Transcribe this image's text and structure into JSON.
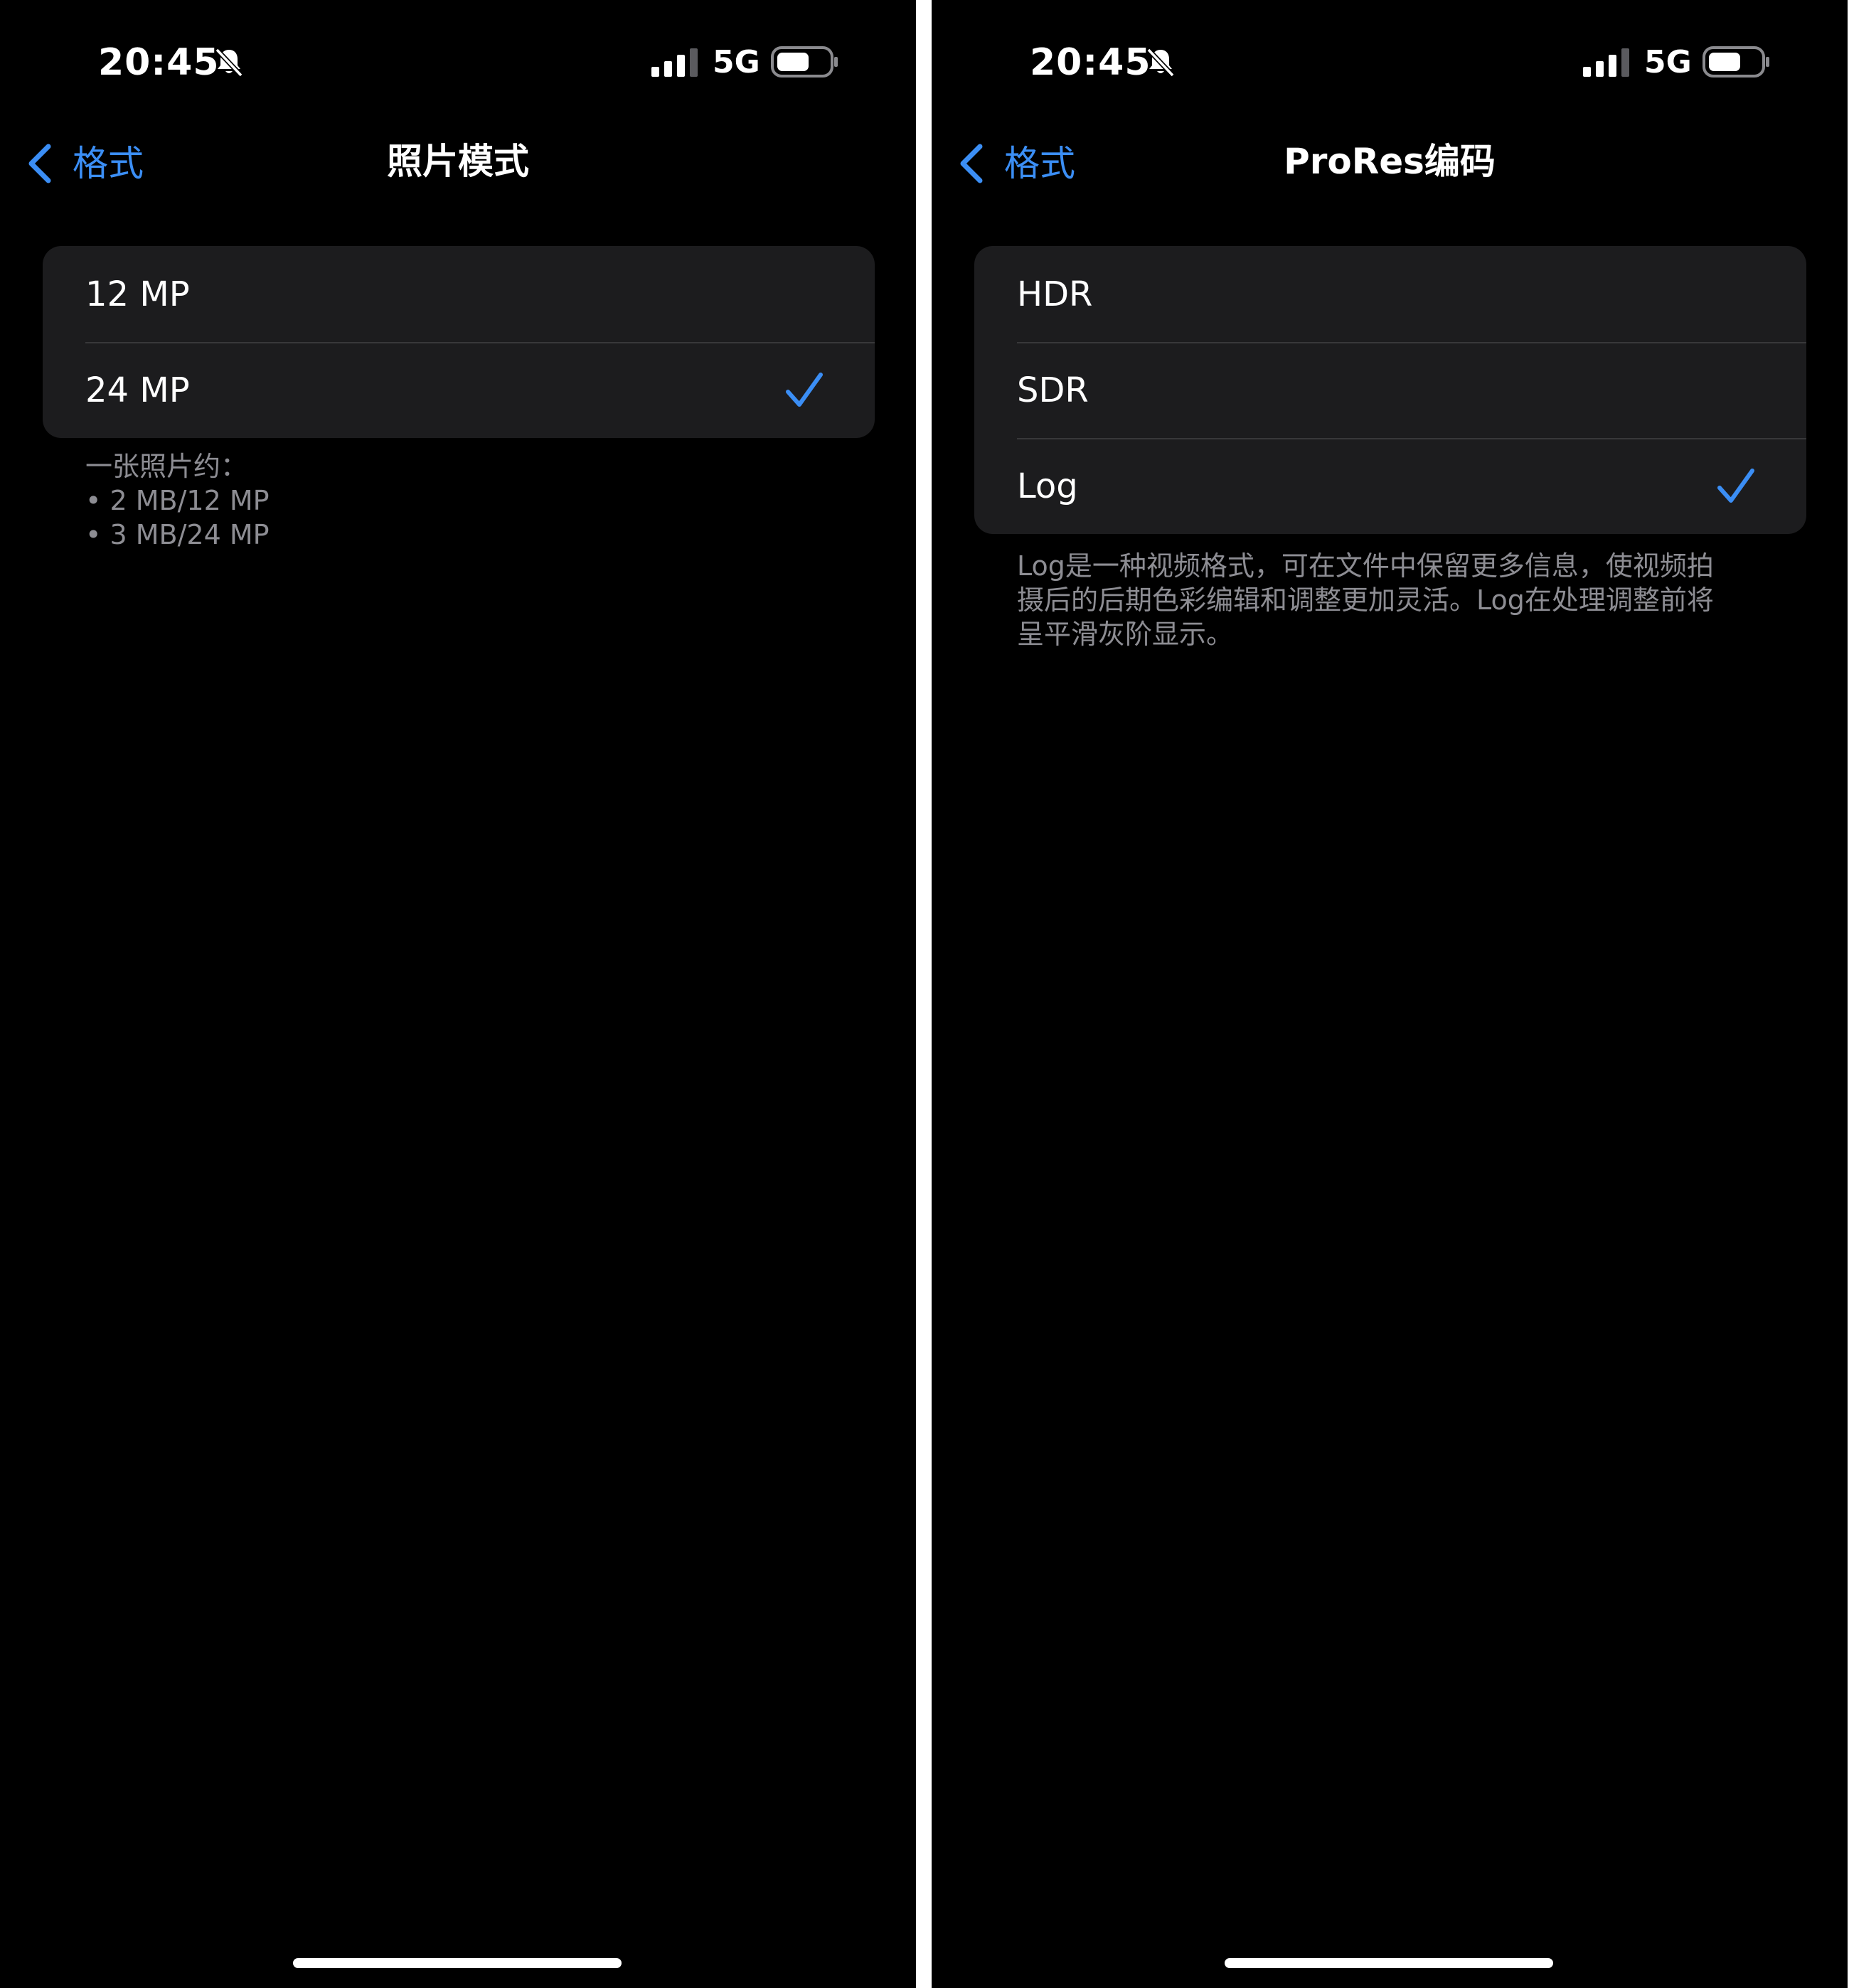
{
  "screens": [
    {
      "status_bar": {
        "time": "20:45",
        "network": "5G"
      },
      "nav": {
        "back_label": "格式",
        "title": "照片模式"
      },
      "options": [
        {
          "label": "12 MP",
          "selected": false
        },
        {
          "label": "24 MP",
          "selected": true
        }
      ],
      "footer": {
        "lines": [
          "一张照片约：",
          "• 2 MB/12 MP",
          "• 3 MB/24 MP"
        ]
      }
    },
    {
      "status_bar": {
        "time": "20:45",
        "network": "5G"
      },
      "nav": {
        "back_label": "格式",
        "title": "ProRes编码"
      },
      "options": [
        {
          "label": "HDR",
          "selected": false
        },
        {
          "label": "SDR",
          "selected": false
        },
        {
          "label": "Log",
          "selected": true
        }
      ],
      "footer": {
        "lines": [
          "Log是一种视频格式，可在文件中保留更多信息，使视频拍",
          "摄后的后期色彩编辑和调整更加灵活。Log在处理调整前将",
          "呈平滑灰阶显示。"
        ]
      }
    }
  ],
  "colors": {
    "accent": "#3b8ef5",
    "background": "#000000",
    "cell": "#1c1c1e",
    "separator": "#38383a",
    "secondary_text": "#8d8d93"
  },
  "icons": {
    "silent": "bell-slash-icon",
    "signal": "cellular-signal-icon",
    "battery": "battery-icon",
    "back": "chevron-left-icon",
    "selected": "checkmark-icon"
  }
}
